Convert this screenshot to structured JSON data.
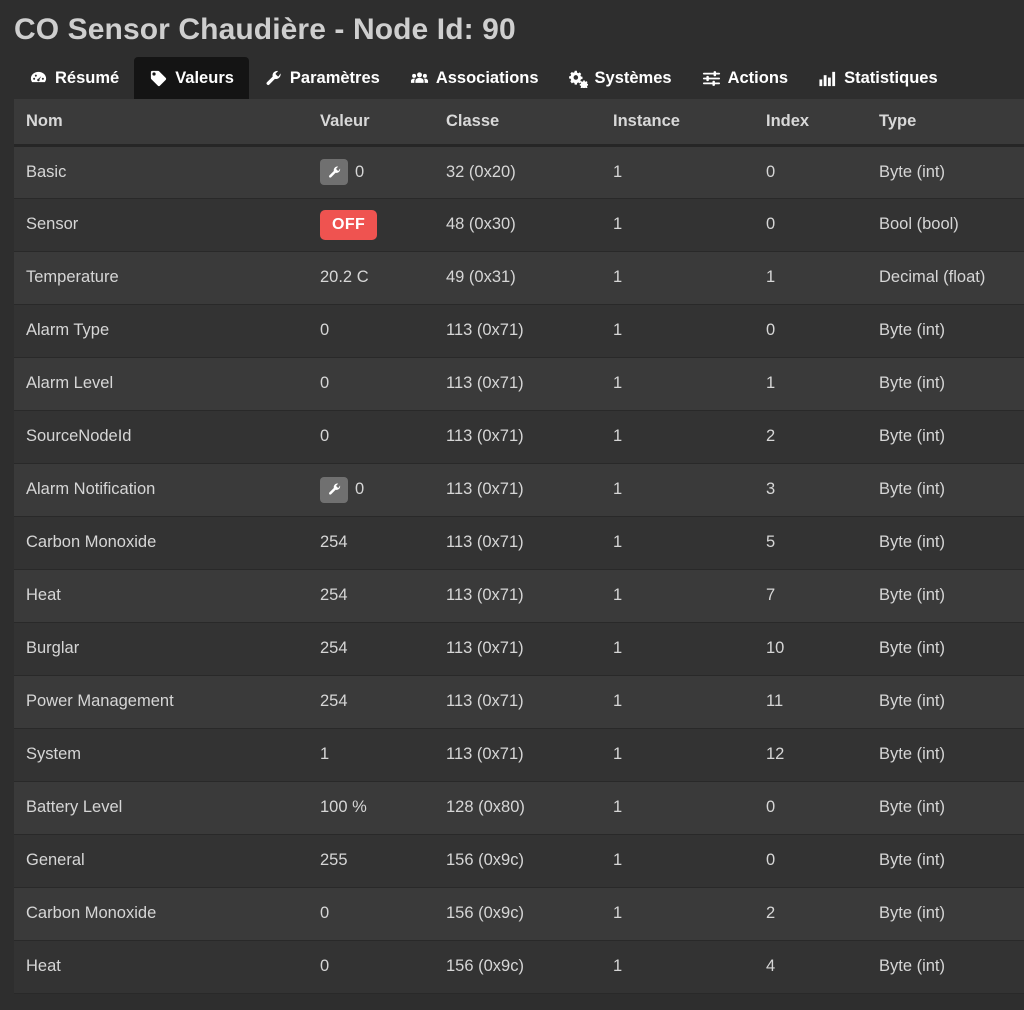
{
  "header": {
    "title": "CO Sensor Chaudière - Node Id: 90"
  },
  "tabs": [
    {
      "label": "Résumé",
      "icon": "tachometer-icon",
      "active": false
    },
    {
      "label": "Valeurs",
      "icon": "tag-icon",
      "active": true
    },
    {
      "label": "Paramètres",
      "icon": "wrench-icon",
      "active": false
    },
    {
      "label": "Associations",
      "icon": "users-icon",
      "active": false
    },
    {
      "label": "Systèmes",
      "icon": "cogs-icon",
      "active": false
    },
    {
      "label": "Actions",
      "icon": "sliders-icon",
      "active": false
    },
    {
      "label": "Statistiques",
      "icon": "bar-chart-icon",
      "active": false
    }
  ],
  "table": {
    "columns": [
      "Nom",
      "Valeur",
      "Classe",
      "Instance",
      "Index",
      "Type"
    ],
    "rows": [
      {
        "nom": "Basic",
        "valeur": "0",
        "widget": "wrench",
        "classe": "32 (0x20)",
        "instance": "1",
        "index": "0",
        "type": "Byte (int)"
      },
      {
        "nom": "Sensor",
        "valeur": "OFF",
        "widget": "badge",
        "classe": "48 (0x30)",
        "instance": "1",
        "index": "0",
        "type": "Bool (bool)"
      },
      {
        "nom": "Temperature",
        "valeur": "20.2 C",
        "widget": "text",
        "classe": "49 (0x31)",
        "instance": "1",
        "index": "1",
        "type": "Decimal (float)"
      },
      {
        "nom": "Alarm Type",
        "valeur": "0",
        "widget": "text",
        "classe": "113 (0x71)",
        "instance": "1",
        "index": "0",
        "type": "Byte (int)"
      },
      {
        "nom": "Alarm Level",
        "valeur": "0",
        "widget": "text",
        "classe": "113 (0x71)",
        "instance": "1",
        "index": "1",
        "type": "Byte (int)"
      },
      {
        "nom": "SourceNodeId",
        "valeur": "0",
        "widget": "text",
        "classe": "113 (0x71)",
        "instance": "1",
        "index": "2",
        "type": "Byte (int)"
      },
      {
        "nom": "Alarm Notification",
        "valeur": "0",
        "widget": "wrench",
        "classe": "113 (0x71)",
        "instance": "1",
        "index": "3",
        "type": "Byte (int)"
      },
      {
        "nom": "Carbon Monoxide",
        "valeur": "254",
        "widget": "text",
        "classe": "113 (0x71)",
        "instance": "1",
        "index": "5",
        "type": "Byte (int)"
      },
      {
        "nom": "Heat",
        "valeur": "254",
        "widget": "text",
        "classe": "113 (0x71)",
        "instance": "1",
        "index": "7",
        "type": "Byte (int)"
      },
      {
        "nom": "Burglar",
        "valeur": "254",
        "widget": "text",
        "classe": "113 (0x71)",
        "instance": "1",
        "index": "10",
        "type": "Byte (int)"
      },
      {
        "nom": "Power Management",
        "valeur": "254",
        "widget": "text",
        "classe": "113 (0x71)",
        "instance": "1",
        "index": "11",
        "type": "Byte (int)"
      },
      {
        "nom": "System",
        "valeur": "1",
        "widget": "text",
        "classe": "113 (0x71)",
        "instance": "1",
        "index": "12",
        "type": "Byte (int)"
      },
      {
        "nom": "Battery Level",
        "valeur": "100 %",
        "widget": "text",
        "classe": "128 (0x80)",
        "instance": "1",
        "index": "0",
        "type": "Byte (int)"
      },
      {
        "nom": "General",
        "valeur": "255",
        "widget": "text",
        "classe": "156 (0x9c)",
        "instance": "1",
        "index": "0",
        "type": "Byte (int)"
      },
      {
        "nom": "Carbon Monoxide",
        "valeur": "0",
        "widget": "text",
        "classe": "156 (0x9c)",
        "instance": "1",
        "index": "2",
        "type": "Byte (int)"
      },
      {
        "nom": "Heat",
        "valeur": "0",
        "widget": "text",
        "classe": "156 (0x9c)",
        "instance": "1",
        "index": "4",
        "type": "Byte (int)"
      }
    ]
  },
  "colors": {
    "page_background": "#2e2e2e",
    "table_background": "#333333",
    "row_alt_background": "#3a3a3a",
    "active_tab_background": "#141414",
    "badge_off": "#ef5350",
    "wrench_button": "#707070",
    "title_text": "#cfcfcf"
  }
}
